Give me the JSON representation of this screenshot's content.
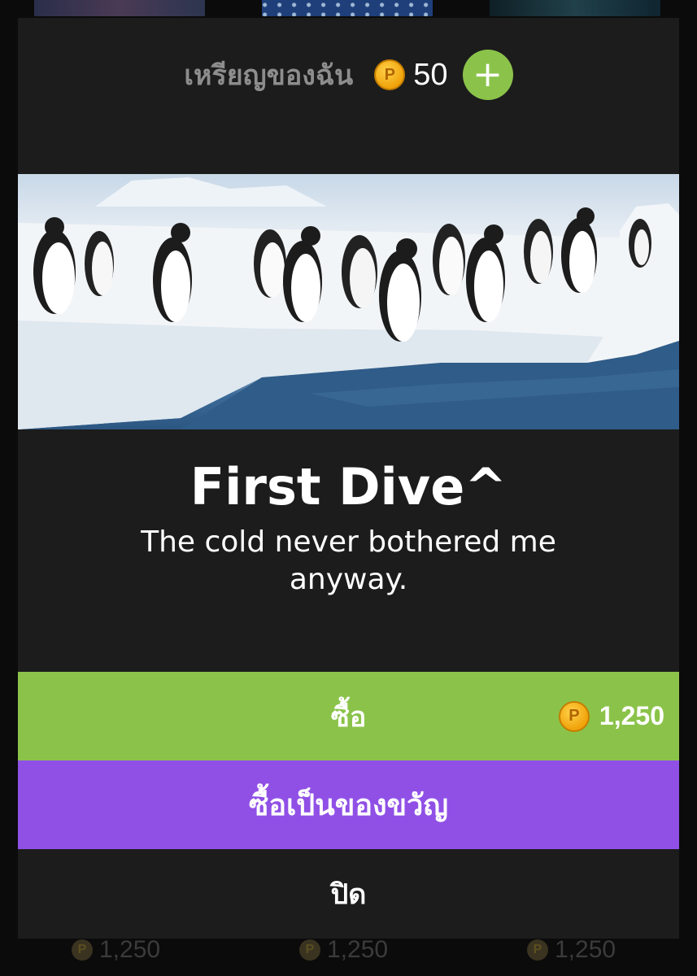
{
  "background": {
    "prices": [
      "1,250",
      "1,250",
      "1,250"
    ]
  },
  "wallet": {
    "label": "เหรียญของฉัน",
    "coin_symbol": "P",
    "balance": "50",
    "add_symbol": "+"
  },
  "item": {
    "title": "First Dive^",
    "description": "The cold never bothered me anyway."
  },
  "actions": {
    "buy_label": "ซื้อ",
    "buy_price": "1,250",
    "gift_label": "ซื้อเป็นของขวัญ",
    "close_label": "ปิด"
  },
  "colors": {
    "accent_green": "#8bc34a",
    "accent_purple": "#9050e6",
    "modal_bg": "#1c1c1c",
    "coin_gold": "#f0a20a"
  }
}
